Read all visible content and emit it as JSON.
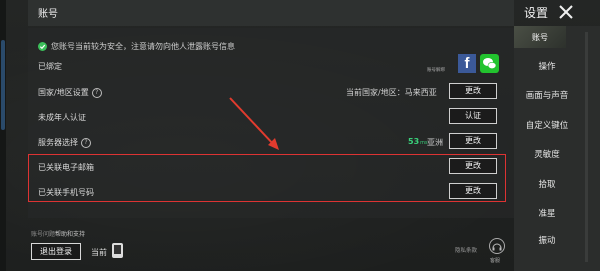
{
  "header": {
    "title": "账号"
  },
  "settings_title": "设置",
  "security_notice": "您账号当前较为安全，注意请勿向他人泄露账号信息",
  "bound": {
    "label": "已绑定",
    "caption": "账号解绑"
  },
  "rows": {
    "country": {
      "label": "国家/地区设置",
      "value": "当前国家/地区：马来西亚",
      "button": "更改"
    },
    "minor": {
      "label": "未成年人认证",
      "button": "认证"
    },
    "server": {
      "label": "服务器选择",
      "ping": "53",
      "ping_unit": "ms",
      "region": "亚洲",
      "button": "更改"
    },
    "email": {
      "label": "已关联电子邮箱",
      "button": "更改"
    },
    "phone": {
      "label": "已关联手机号码",
      "button": "更改"
    }
  },
  "footer": {
    "prefix": "账号问题",
    "link": "帮助和支持",
    "logout": "退出登录",
    "current": "当前",
    "privacy": "隐私条款",
    "cs": "客服"
  },
  "sidebar": {
    "items": [
      "账号",
      "操作",
      "画面与声音",
      "自定义键位",
      "灵敏度",
      "拾取",
      "准星",
      "振动"
    ]
  },
  "colors": {
    "ping": "#39d07a",
    "highlight": "#dd3333",
    "facebook": "#3b5998",
    "wechat": "#22c32e"
  }
}
